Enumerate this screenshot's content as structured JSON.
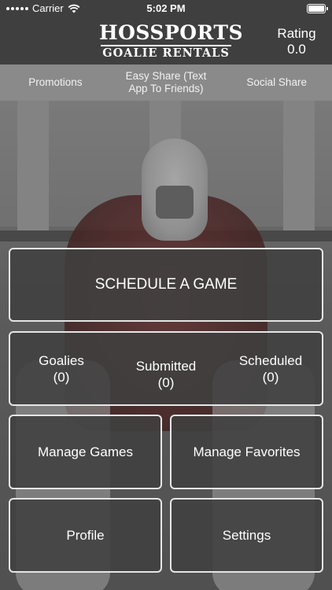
{
  "status_bar": {
    "carrier": "Carrier",
    "time": "5:02 PM"
  },
  "header": {
    "logo_line1": "HOSSPORTS",
    "logo_line2": "GOALIE RENTALS",
    "rating_label": "Rating",
    "rating_value": "0.0"
  },
  "subnav": {
    "items": [
      {
        "label": "Promotions"
      },
      {
        "label": "Easy Share (Text App To Friends)"
      },
      {
        "label": "Social Share"
      }
    ]
  },
  "main": {
    "schedule_label": "SCHEDULE A GAME",
    "counts": [
      {
        "label": "Goalies",
        "value": "(0)"
      },
      {
        "label": "Submitted",
        "value": "(0)"
      },
      {
        "label": "Scheduled",
        "value": "(0)"
      }
    ],
    "manage_games_label": "Manage Games",
    "manage_favorites_label": "Manage Favorites",
    "profile_label": "Profile",
    "settings_label": "Settings"
  }
}
